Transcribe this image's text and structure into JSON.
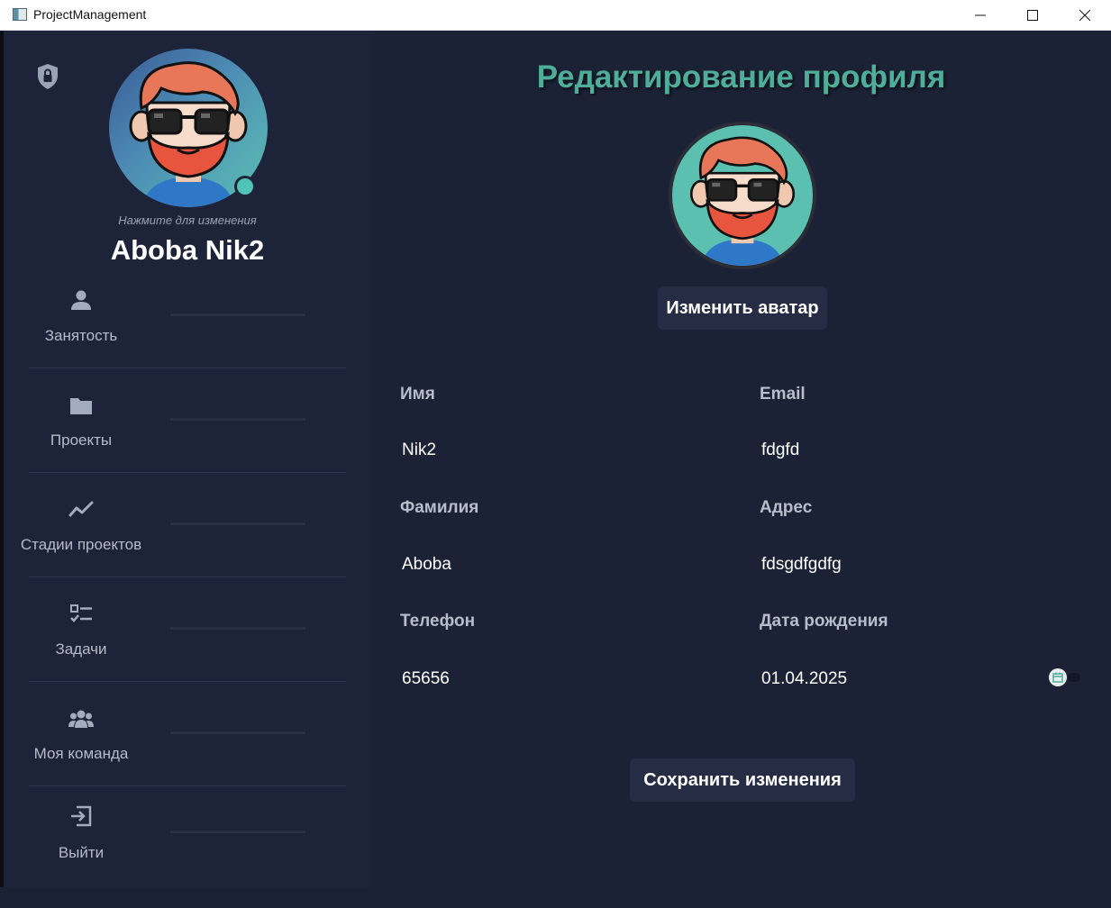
{
  "window": {
    "title": "ProjectManagement"
  },
  "sidebar": {
    "hint": "Нажмите для изменения",
    "username": "Aboba Nik2",
    "items": [
      {
        "label": "Занятость",
        "icon": "person-icon"
      },
      {
        "label": "Проекты",
        "icon": "folder-icon"
      },
      {
        "label": "Стадии проектов",
        "icon": "trend-icon"
      },
      {
        "label": "Задачи",
        "icon": "checklist-icon"
      },
      {
        "label": "Моя команда",
        "icon": "team-icon"
      },
      {
        "label": "Выйти",
        "icon": "logout-icon"
      }
    ]
  },
  "main": {
    "title": "Редактирование профиля",
    "change_avatar": "Изменить аватар",
    "fields": {
      "first_name": {
        "label": "Имя",
        "value": "Nik2"
      },
      "email": {
        "label": "Email",
        "value": "fdgfd"
      },
      "last_name": {
        "label": "Фамилия",
        "value": "Aboba"
      },
      "address": {
        "label": "Адрес",
        "value": "fdsgdfgdfg"
      },
      "phone": {
        "label": "Телефон",
        "value": "65656"
      },
      "birthdate": {
        "label": "Дата рождения",
        "value": "01.04.2025"
      }
    },
    "save": "Сохранить изменения"
  },
  "colors": {
    "background": "#1c2236",
    "sidebar": "#1d2338",
    "accent": "#4fae9a",
    "button": "#262c44",
    "status": "#4fc3b5"
  }
}
